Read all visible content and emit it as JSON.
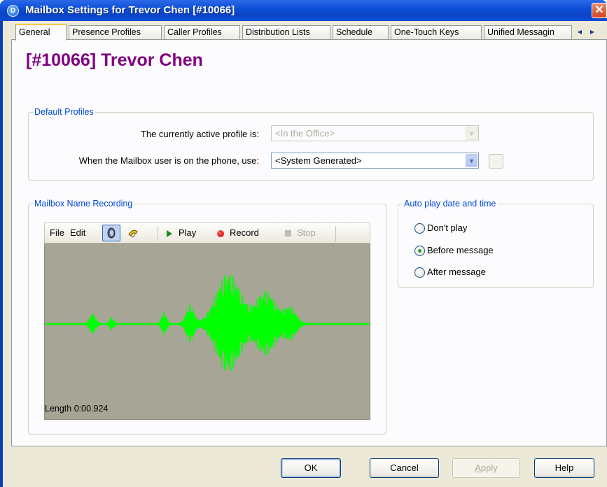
{
  "window": {
    "title": "Mailbox Settings for Trevor Chen [#10066]",
    "app_icon_letter": "D",
    "close_glyph": "✕"
  },
  "tabs": [
    {
      "label": "General",
      "active": true
    },
    {
      "label": "Presence Profiles"
    },
    {
      "label": "Caller Profiles"
    },
    {
      "label": "Distribution Lists"
    },
    {
      "label": "Schedule"
    },
    {
      "label": "One-Touch Keys"
    },
    {
      "label": "Unified Messagin"
    }
  ],
  "tab_scroll": {
    "left": "◀",
    "right": "▶"
  },
  "heading": "[#10066] Trevor Chen",
  "default_profiles": {
    "legend": "Default Profiles",
    "active_label": "The currently active profile is:",
    "active_value": "<In the Office>",
    "phone_label": "When the Mailbox user is on the phone, use:",
    "phone_value": "<System Generated>",
    "extra_button": "..."
  },
  "recording": {
    "legend": "Mailbox Name Recording",
    "menu_file": "File",
    "menu_edit": "Edit",
    "play_label": "Play",
    "record_label": "Record",
    "stop_label": "Stop",
    "length_text": "Length 0:00.924",
    "wave_color": "#00ff00"
  },
  "autoplay": {
    "legend": "Auto play date and time",
    "options": [
      {
        "label": "Don't play",
        "checked": false
      },
      {
        "label": "Before message",
        "checked": true
      },
      {
        "label": "After message",
        "checked": false
      }
    ]
  },
  "buttons": {
    "ok": "OK",
    "cancel": "Cancel",
    "apply_first": "A",
    "apply_rest": "pply",
    "help": "Help"
  },
  "colors": {
    "heading": "#800080",
    "legend": "#0046d5",
    "titlebar": "#0b4cd4"
  }
}
